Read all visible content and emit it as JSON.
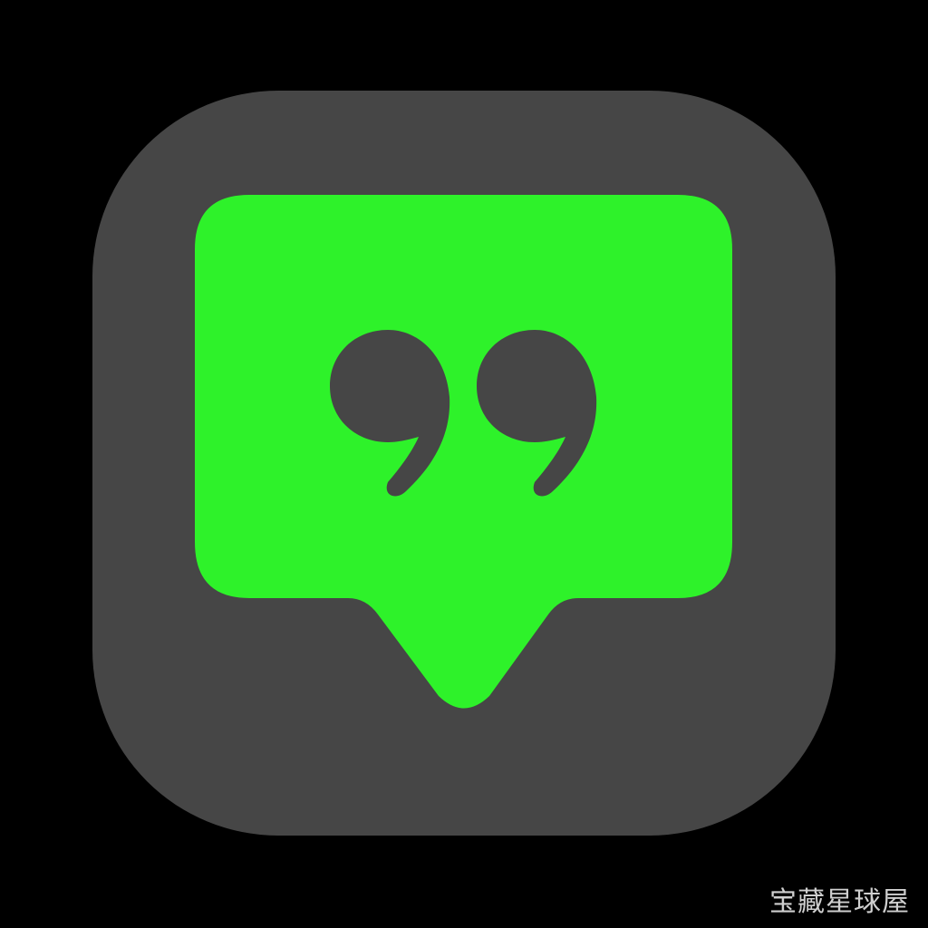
{
  "colors": {
    "background": "#000000",
    "icon_tile": "#464646",
    "speech_bubble": "#2ef22a",
    "quote_marks": "#464646",
    "watermark_text": "#cfcfcf"
  },
  "icon": {
    "name": "quote-speech-bubble-icon"
  },
  "watermark": {
    "text": "宝藏星球屋"
  }
}
